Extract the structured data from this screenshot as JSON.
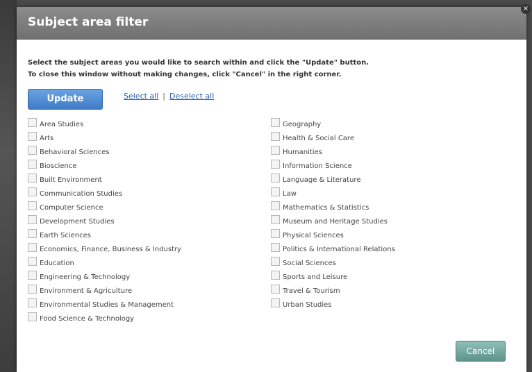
{
  "dialog": {
    "title": "Subject area filter",
    "instruction_line1": "Select the subject areas you would like to search within and click the \"Update\" button.",
    "instruction_line2": "To close this window without making changes, click \"Cancel\" in the right corner.",
    "update_label": "Update",
    "select_all_label": "Select all",
    "separator": "|",
    "deselect_all_label": "Deselect all",
    "cancel_label": "Cancel",
    "close_glyph": "×"
  },
  "subjects_left": [
    {
      "label": "Area Studies"
    },
    {
      "label": "Arts"
    },
    {
      "label": "Behavioral Sciences"
    },
    {
      "label": "Bioscience"
    },
    {
      "label": "Built Environment"
    },
    {
      "label": "Communication Studies"
    },
    {
      "label": "Computer Science"
    },
    {
      "label": "Development Studies"
    },
    {
      "label": "Earth Sciences"
    },
    {
      "label": "Economics, Finance, Business & Industry"
    },
    {
      "label": "Education"
    },
    {
      "label": "Engineering & Technology"
    },
    {
      "label": "Environment & Agriculture"
    },
    {
      "label": "Environmental Studies & Management"
    },
    {
      "label": "Food Science & Technology"
    }
  ],
  "subjects_right": [
    {
      "label": "Geography"
    },
    {
      "label": "Health & Social Care"
    },
    {
      "label": "Humanities"
    },
    {
      "label": "Information Science"
    },
    {
      "label": "Language & Literature"
    },
    {
      "label": "Law"
    },
    {
      "label": "Mathematics & Statistics"
    },
    {
      "label": "Museum and Heritage Studies"
    },
    {
      "label": "Physical Sciences"
    },
    {
      "label": "Politics & International Relations"
    },
    {
      "label": "Social Sciences"
    },
    {
      "label": "Sports and Leisure"
    },
    {
      "label": "Travel & Tourism"
    },
    {
      "label": "Urban Studies"
    }
  ],
  "colors": {
    "header": "#7d7d7d",
    "update_button": "#4f8bd3",
    "cancel_button": "#6fa69e",
    "link": "#2a5db0"
  }
}
